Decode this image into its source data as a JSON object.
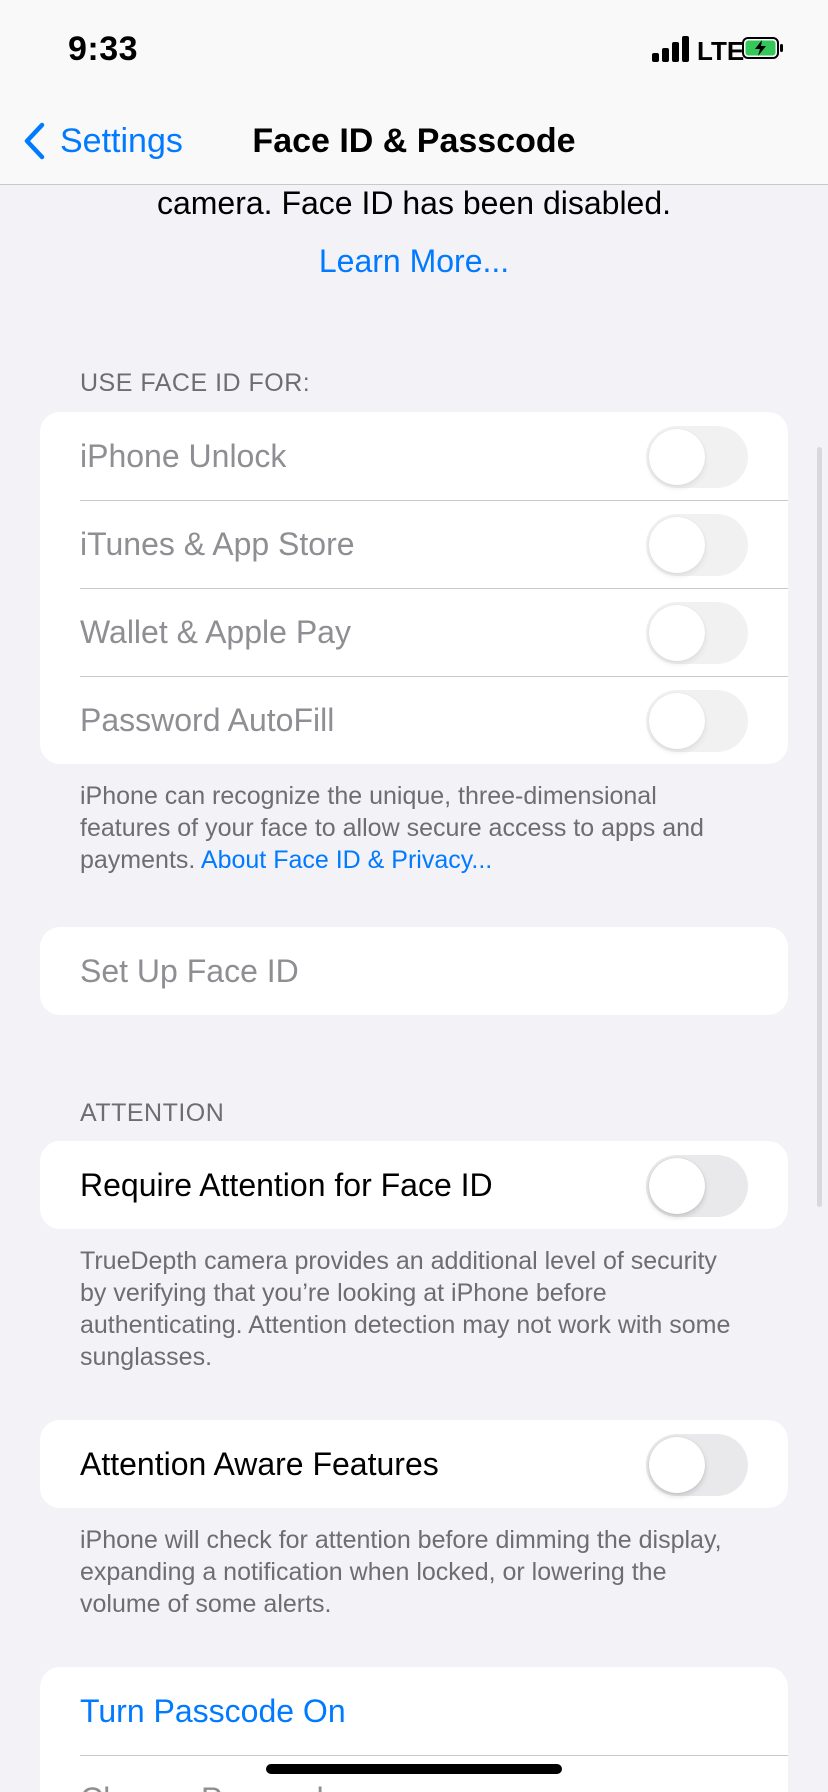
{
  "status_bar": {
    "time": "9:33",
    "network": "LTE",
    "icons": [
      "cellular-signal-icon",
      "battery-charging-icon"
    ]
  },
  "nav": {
    "back_label": "Settings",
    "title": "Face ID & Passcode"
  },
  "intro": {
    "text": "camera. Face ID has been disabled.",
    "learn_more": "Learn More..."
  },
  "use_face_id": {
    "header": "USE FACE ID FOR:",
    "items": [
      {
        "label": "iPhone Unlock",
        "on": false
      },
      {
        "label": "iTunes & App Store",
        "on": false
      },
      {
        "label": "Wallet & Apple Pay",
        "on": false
      },
      {
        "label": "Password AutoFill",
        "on": false
      }
    ],
    "footer_text": "iPhone can recognize the unique, three-dimensional features of your face to allow secure access to apps and payments.",
    "footer_link": "About Face ID & Privacy..."
  },
  "setup": {
    "label": "Set Up Face ID"
  },
  "attention": {
    "header": "ATTENTION",
    "require_label": "Require Attention for Face ID",
    "require_on": false,
    "require_footer": "TrueDepth camera provides an additional level of security by verifying that you’re looking at iPhone before authenticating. Attention detection may not work with some sunglasses.",
    "aware_label": "Attention Aware Features",
    "aware_on": false,
    "aware_footer": "iPhone will check for attention before dimming the display, expanding a notification when locked, or lowering the volume of some alerts."
  },
  "passcode": {
    "turn_on_label": "Turn Passcode On",
    "change_label": "Change Passcode"
  },
  "colors": {
    "accent": "#007aff",
    "background": "#f2f2f7",
    "toggle_off": "#e9e9eb",
    "battery_green": "#34c759"
  }
}
